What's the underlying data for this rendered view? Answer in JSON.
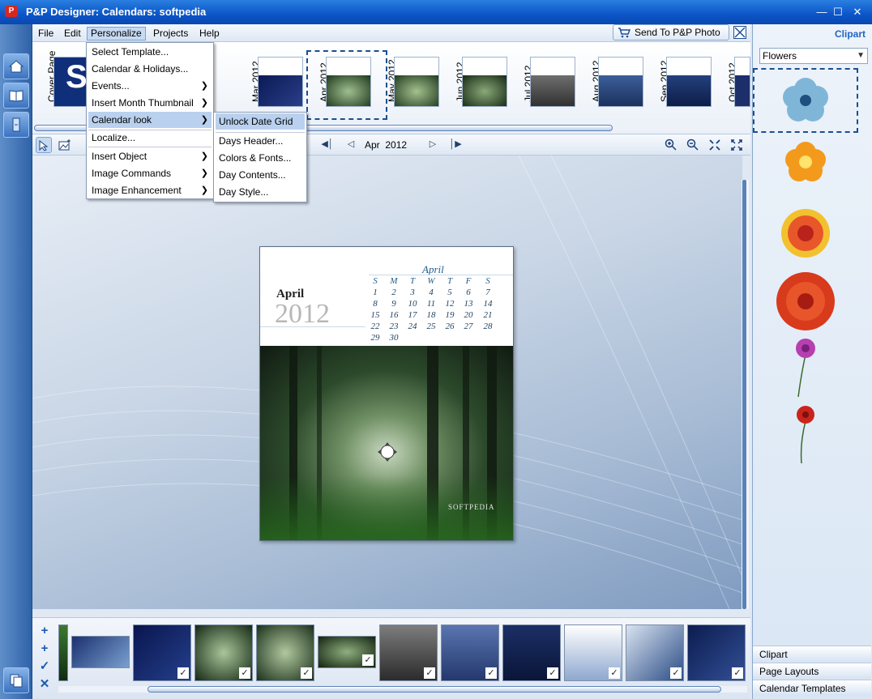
{
  "window": {
    "title": "P&P Designer: Calendars: softpedia"
  },
  "menubar": {
    "items": [
      "File",
      "Edit",
      "Personalize",
      "Projects",
      "Help"
    ],
    "send_label": "Send To  P&P Photo"
  },
  "thumbs": [
    {
      "label": "Cover Page",
      "theme": "cover"
    },
    {
      "label": "",
      "theme": "hidden"
    },
    {
      "label": "Mar  2012",
      "theme": "blue"
    },
    {
      "label": "Apr  2012",
      "theme": "forest"
    },
    {
      "label": "May  2012",
      "theme": "forest"
    },
    {
      "label": "Jun  2012",
      "theme": "forest"
    },
    {
      "label": "Jul  2012",
      "theme": "gray"
    },
    {
      "label": "Aug  2012",
      "theme": "blue"
    },
    {
      "label": "Sep  2012",
      "theme": "blue"
    },
    {
      "label": "Oct  2012",
      "theme": "blue"
    }
  ],
  "toolbar": {
    "nav_month": "Apr",
    "nav_year": "2012"
  },
  "calendar": {
    "month": "April",
    "year": "2012",
    "grid_title": "April",
    "weekdays": [
      "S",
      "M",
      "T",
      "W",
      "T",
      "F",
      "S"
    ],
    "weeks": [
      [
        "1",
        "2",
        "3",
        "4",
        "5",
        "6",
        "7"
      ],
      [
        "8",
        "9",
        "10",
        "11",
        "12",
        "13",
        "14"
      ],
      [
        "15",
        "16",
        "17",
        "18",
        "19",
        "20",
        "21"
      ],
      [
        "22",
        "23",
        "24",
        "25",
        "26",
        "27",
        "28"
      ],
      [
        "29",
        "30",
        "",
        "",
        "",
        "",
        ""
      ]
    ],
    "watermark": "SOFTPEDIA"
  },
  "personalize_menu": {
    "items": [
      {
        "label": "Select Template...",
        "submenu": false
      },
      {
        "label": "Calendar & Holidays...",
        "submenu": false
      },
      {
        "label": "Events...",
        "submenu": true
      },
      {
        "label": "Insert Month Thumbnail",
        "submenu": true
      },
      {
        "label": "Calendar look",
        "submenu": true
      },
      {
        "label": "Localize...",
        "submenu": false
      },
      {
        "label": "Insert Object",
        "submenu": true
      },
      {
        "label": "Image Commands",
        "submenu": true
      },
      {
        "label": "Image Enhancement",
        "submenu": true
      }
    ]
  },
  "calendar_look_menu": {
    "items": [
      "Unlock Date Grid",
      "Days Header...",
      "Colors & Fonts...",
      "Day Contents...",
      "Day Style..."
    ]
  },
  "right_panel": {
    "title": "Clipart",
    "category": "Flowers",
    "tabs": [
      "Clipart",
      "Page Layouts",
      "Calendar Templates"
    ]
  },
  "colors": {
    "accent": "#0b55c8",
    "highlight": "#b9d1ee",
    "panel_title": "#2265c2"
  }
}
